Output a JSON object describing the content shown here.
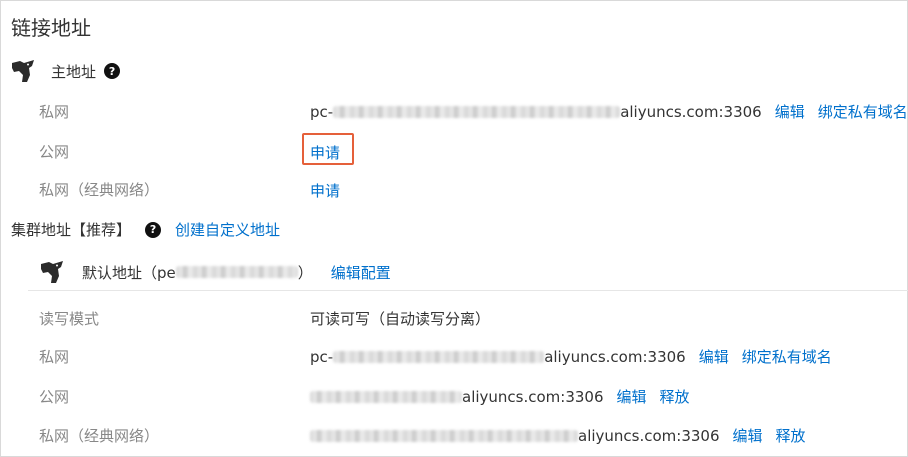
{
  "page": {
    "title": "链接地址"
  },
  "primary": {
    "heading": "主地址",
    "help": "?",
    "rows": [
      {
        "label": "私网",
        "prefix": "pc-",
        "suffix": "aliyuncs.com:3306",
        "links": [
          "编辑",
          "绑定私有域名"
        ]
      },
      {
        "label": "公网",
        "apply": "申请"
      },
      {
        "label": "私网（经典网络）",
        "apply": "申请"
      }
    ]
  },
  "cluster": {
    "heading": "集群地址【推荐】",
    "help": "?",
    "create_link": "创建自定义地址",
    "default_name": "默认地址（pe",
    "default_close": "）",
    "edit_config": "编辑配置",
    "rows": [
      {
        "label": "读写模式",
        "value": "可读可写（自动读写分离）"
      },
      {
        "label": "私网",
        "prefix": "pc-",
        "suffix": "aliyuncs.com:3306",
        "links": [
          "编辑",
          "绑定私有域名"
        ]
      },
      {
        "label": "公网",
        "prefix": "",
        "suffix": "aliyuncs.com:3306",
        "links": [
          "编辑",
          "释放"
        ]
      },
      {
        "label": "私网（经典网络）",
        "prefix": "",
        "suffix": "aliyuncs.com:3306",
        "links": [
          "编辑",
          "释放"
        ]
      }
    ]
  },
  "icons": {
    "brand": "polardb-bear-logo",
    "help": "question-circle-icon"
  },
  "colors": {
    "link": "#0070cc",
    "highlight": "#e5603a",
    "muted": "#888888"
  }
}
